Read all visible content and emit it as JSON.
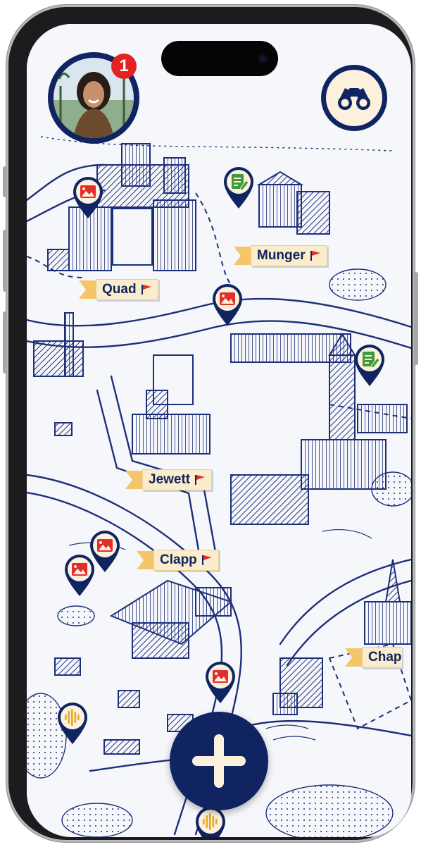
{
  "profile": {
    "notification_count": "1",
    "avatar_icon": "user-photo"
  },
  "explore": {
    "icon": "binoculars-icon"
  },
  "map": {
    "style": "hand-drawn campus map",
    "ink": "#1e2f7a",
    "paper": "#f6f7fb"
  },
  "labels": [
    {
      "id": "munger",
      "text": "Munger"
    },
    {
      "id": "quad",
      "text": "Quad"
    },
    {
      "id": "jewett",
      "text": "Jewett"
    },
    {
      "id": "clapp",
      "text": "Clapp"
    },
    {
      "id": "chapel",
      "text": "Chap"
    }
  ],
  "pins": [
    {
      "type": "photo"
    },
    {
      "type": "note"
    },
    {
      "type": "photo"
    },
    {
      "type": "note"
    },
    {
      "type": "photo"
    },
    {
      "type": "photo"
    },
    {
      "type": "photo"
    },
    {
      "type": "audio"
    },
    {
      "type": "audio"
    }
  ],
  "colors": {
    "navy": "#0f2460",
    "cream": "#fbf1dc",
    "photo_red": "#e32d2d",
    "note_green": "#3e9b3c",
    "audio_gold": "#e8a820",
    "badge_red": "#e32222"
  },
  "add_button": {
    "icon": "plus-icon"
  }
}
